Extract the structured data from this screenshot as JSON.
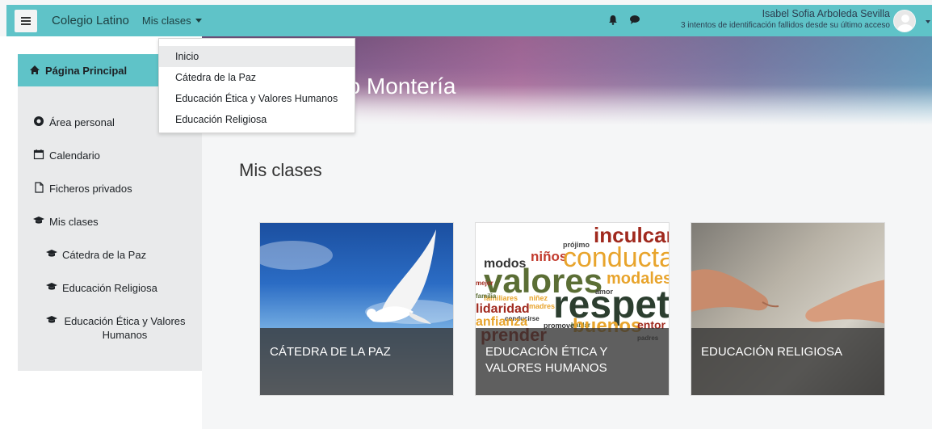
{
  "navbar": {
    "brand": "Colegio Latino",
    "menu_label": "Mis clases",
    "user_name": "Isabel Sofia Arboleda Sevilla",
    "user_subtitle": "3 intentos de identificación fallidos desde su último acceso",
    "icons": [
      "hamburger-icon",
      "bell-icon",
      "chat-bubble-icon",
      "avatar"
    ]
  },
  "dropdown": {
    "items": [
      "Inicio",
      "Cátedra de la Paz",
      "Educación Ética y Valores Humanos",
      "Educación Religiosa"
    ]
  },
  "hero": {
    "title": "no Montería"
  },
  "sidebar": {
    "items": [
      {
        "label": "Página Principal",
        "icon": "home-icon"
      },
      {
        "label": "Área personal",
        "icon": "dashboard-icon"
      },
      {
        "label": "Calendario",
        "icon": "calendar-icon"
      },
      {
        "label": "Ficheros privados",
        "icon": "file-icon"
      },
      {
        "label": "Mis clases",
        "icon": "graduation-cap-icon"
      },
      {
        "label": "Cátedra de la Paz",
        "icon": "graduation-cap-icon"
      },
      {
        "label": "Educación Religiosa",
        "icon": "graduation-cap-icon"
      },
      {
        "label": "Educación Ética y Valores Humanos",
        "icon": "graduation-cap-icon"
      }
    ]
  },
  "main": {
    "section_title": "Mis clases",
    "courses": [
      {
        "title": "CÁTEDRA DE LA PAZ"
      },
      {
        "title": "EDUCACIÓN ÉTICA Y VALORES HUMANOS"
      },
      {
        "title": "EDUCACIÓN RELIGIOSA"
      }
    ],
    "wordcloud": [
      "inculcar",
      "prójimo",
      "modos",
      "niños",
      "conducta",
      "valores",
      "modales",
      "amor",
      "familiares",
      "lidaridad",
      "madres",
      "niñez",
      "respeto",
      "conducirse",
      "promover",
      "hablar",
      "buenos",
      "padres",
      "entor",
      "anfianza",
      "prender",
      "mejor",
      "familia"
    ]
  },
  "colors": {
    "accent": "#5fc3c8",
    "drawer": "#e9eaeb"
  }
}
